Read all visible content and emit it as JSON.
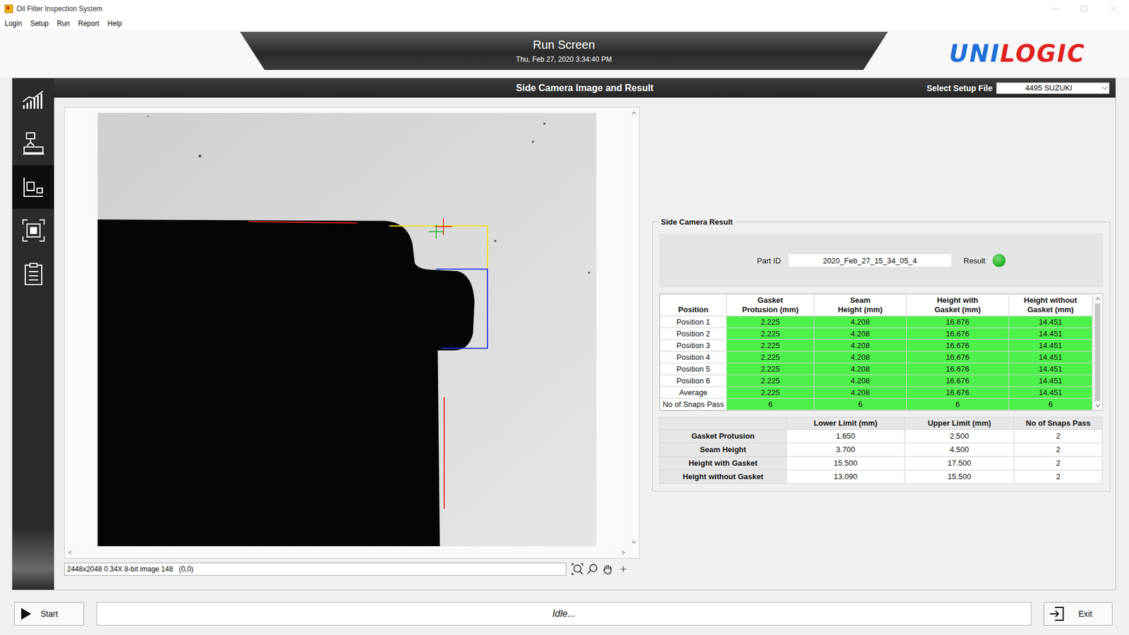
{
  "window": {
    "title": "Oil Filter Inspection System"
  },
  "menu": [
    {
      "label": "Login"
    },
    {
      "label": "Setup"
    },
    {
      "label": "Run"
    },
    {
      "label": "Report"
    },
    {
      "label": "Help"
    }
  ],
  "header": {
    "title": "Run Screen",
    "datetime": "Thu, Feb 27, 2020 3:34:40 PM",
    "logo": [
      {
        "text": "UNI",
        "color": "#1f6fd6"
      },
      {
        "text": "LOGIC",
        "color": "#e0221f"
      }
    ]
  },
  "section_bar": {
    "title": "Side Camera Image and Result",
    "setup_label": "Select Setup File",
    "setup_value": "4495 SUZUKI"
  },
  "sidebar": {
    "items": [
      {
        "selected": false
      },
      {
        "selected": false
      },
      {
        "selected": true
      },
      {
        "selected": false
      },
      {
        "selected": false
      }
    ]
  },
  "image_viewer": {
    "status": "2448x2048 0.34X 8-bit image 148",
    "coords": "(0,0)"
  },
  "result": {
    "group_title": "Side Camera Result",
    "part_id_label": "Part ID",
    "part_id": "2020_Feb_27_15_34_05_4",
    "result_label": "Result",
    "passed": true
  },
  "measurements": {
    "columns": [
      {
        "lines": [
          "Position"
        ]
      },
      {
        "lines": [
          "Gasket",
          "Protusion (mm)"
        ]
      },
      {
        "lines": [
          "Seam",
          "Height (mm)"
        ]
      },
      {
        "lines": [
          "Height with",
          "Gasket (mm)"
        ]
      },
      {
        "lines": [
          "Height without",
          "Gasket (mm)"
        ]
      }
    ],
    "rows": [
      {
        "label": "Position 1",
        "values": [
          "2.225",
          "4.208",
          "16.676",
          "14.451"
        ],
        "pass": true
      },
      {
        "label": "Position 2",
        "values": [
          "2.225",
          "4.208",
          "16.676",
          "14.451"
        ],
        "pass": true
      },
      {
        "label": "Position 3",
        "values": [
          "2.225",
          "4.208",
          "16.676",
          "14.451"
        ],
        "pass": true
      },
      {
        "label": "Position 4",
        "values": [
          "2.225",
          "4.208",
          "16.676",
          "14.451"
        ],
        "pass": true
      },
      {
        "label": "Position 5",
        "values": [
          "2.225",
          "4.208",
          "16.676",
          "14.451"
        ],
        "pass": true
      },
      {
        "label": "Position 6",
        "values": [
          "2.225",
          "4.208",
          "16.676",
          "14.451"
        ],
        "pass": true
      },
      {
        "label": "Average",
        "values": [
          "2.225",
          "4.208",
          "16.676",
          "14.451"
        ],
        "pass": true
      },
      {
        "label": "No of Snaps Pass",
        "values": [
          "6",
          "6",
          "6",
          "6"
        ],
        "pass": true
      }
    ]
  },
  "limits": {
    "columns": [
      "",
      "Lower Limit (mm)",
      "Upper Limit (mm)",
      "No of Snaps Pass"
    ],
    "rows": [
      {
        "label": "Gasket Protusion",
        "lower": "1.650",
        "upper": "2.500",
        "snaps": "2"
      },
      {
        "label": "Seam Height",
        "lower": "3.700",
        "upper": "4.500",
        "snaps": "2"
      },
      {
        "label": "Height with Gasket",
        "lower": "15.500",
        "upper": "17.500",
        "snaps": "2"
      },
      {
        "label": "Height without Gasket",
        "lower": "13.090",
        "upper": "15.500",
        "snaps": "2"
      }
    ]
  },
  "bottom": {
    "start": "Start",
    "status": "Idle...",
    "exit": "Exit"
  }
}
